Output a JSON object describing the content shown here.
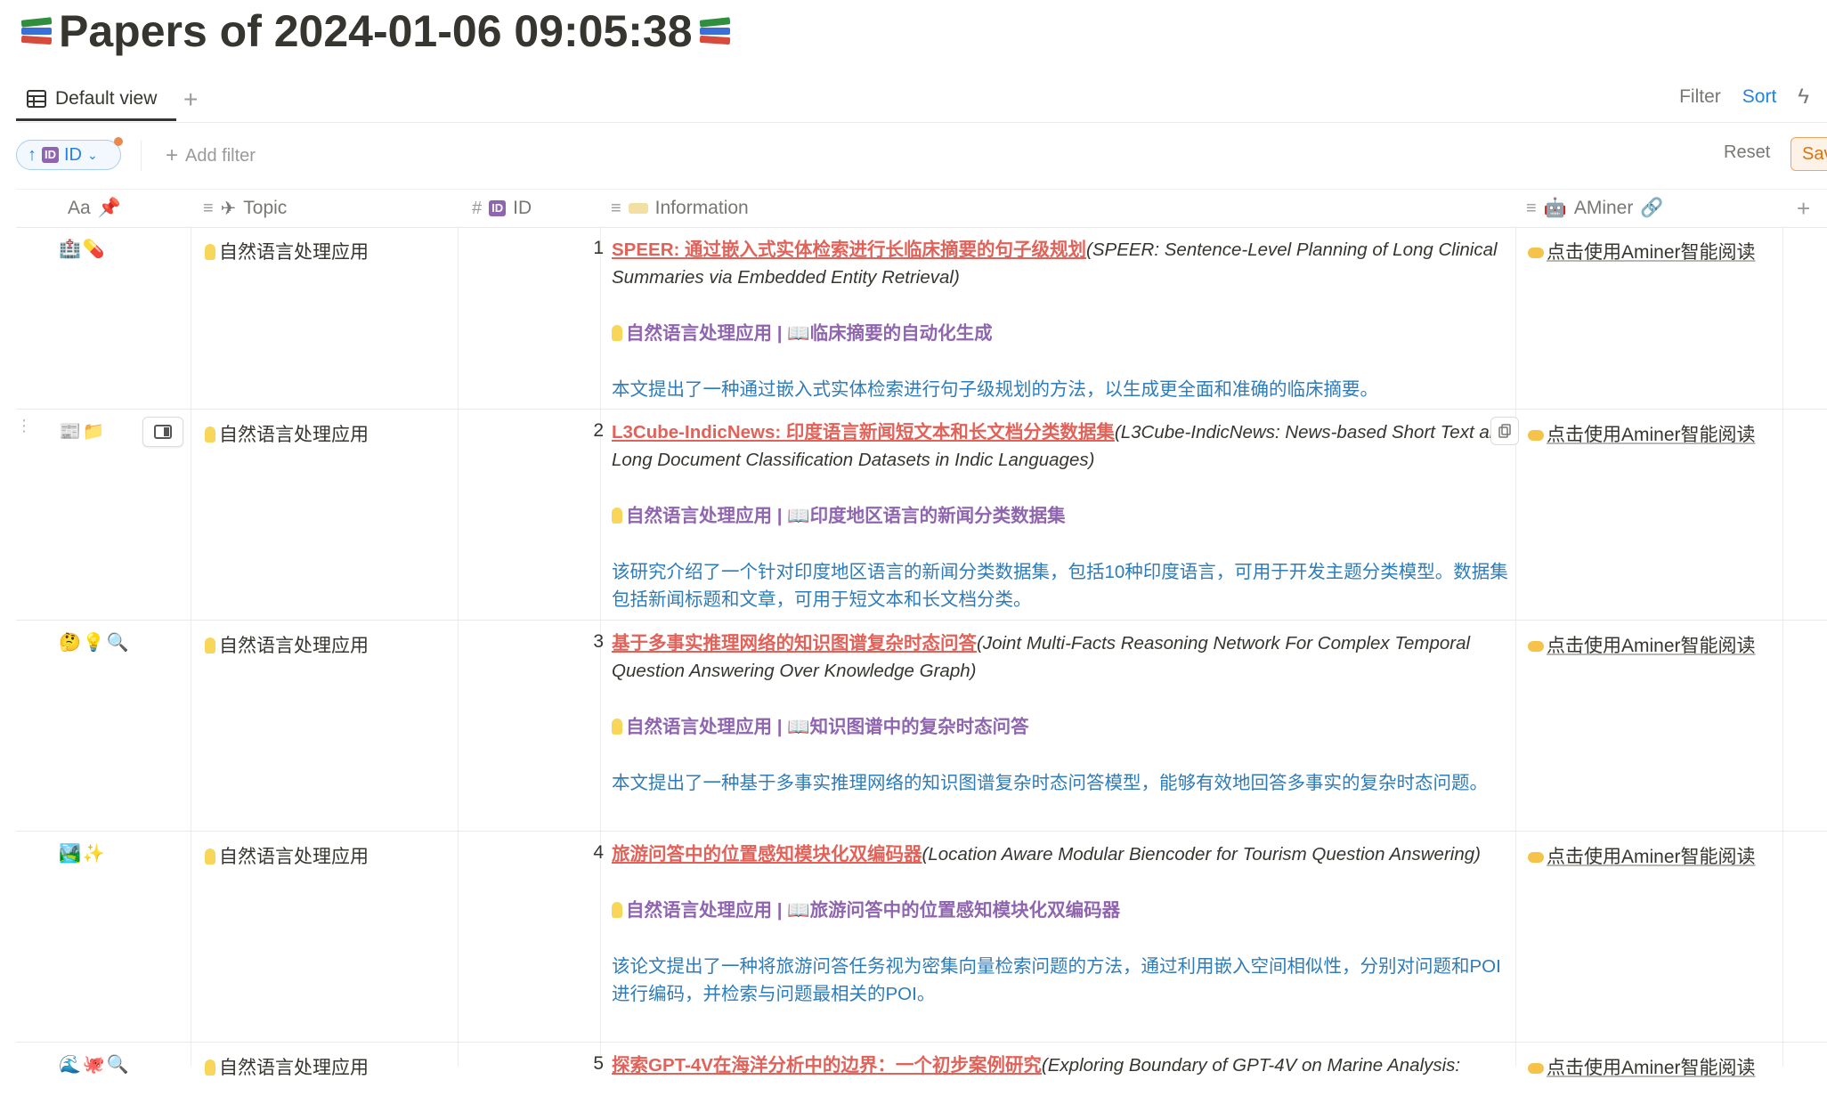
{
  "page": {
    "title": "Papers of 2024-01-06 09:05:38",
    "title_icon": "books-icon"
  },
  "tabs": [
    {
      "label": "Default view",
      "active": true
    }
  ],
  "toolbar": {
    "filter_label": "Filter",
    "sort_label": "Sort",
    "add_filter_label": "Add filter",
    "reset_label": "Reset",
    "save_label": "Sav",
    "sort_chip": {
      "direction": "↑",
      "badge": "ID",
      "label": "ID"
    }
  },
  "columns": [
    {
      "key": "name",
      "label": "Aa",
      "icon": "pin-icon"
    },
    {
      "key": "topic",
      "label": "Topic",
      "icon": "airplane-icon"
    },
    {
      "key": "id",
      "label": "ID",
      "icon": "hash-icon"
    },
    {
      "key": "info",
      "label": "Information",
      "icon": "tag-icon"
    },
    {
      "key": "aminer",
      "label": "AMiner",
      "icon": "robot-icon"
    }
  ],
  "rows": [
    {
      "emoji": "🏥💊",
      "topic": "自然语言处理应用",
      "id": "1",
      "title_zh": "SPEER: 通过嵌入式实体检索进行长临床摘要的句子级规划",
      "title_en": "(SPEER: Sentence-Level Planning of Long Clinical Summaries via Embedded Entity Retrieval)",
      "subtopic": "自然语言处理应用 | 📖临床摘要的自动化生成",
      "abstract": "本文提出了一种通过嵌入式实体检索进行句子级规划的方法，以生成更全面和准确的临床摘要。",
      "aminer": "点击使用Aminer智能阅读"
    },
    {
      "emoji": "📰📁",
      "topic": "自然语言处理应用",
      "id": "2",
      "title_zh": "L3Cube-IndicNews: 印度语言新闻短文本和长文档分类数据集",
      "title_en": "(L3Cube-IndicNews: News-based Short Text and Long Document Classification Datasets in Indic Languages)",
      "subtopic": "自然语言处理应用 | 📖印度地区语言的新闻分类数据集",
      "abstract": "该研究介绍了一个针对印度地区语言的新闻分类数据集，包括10种印度语言，可用于开发主题分类模型。数据集包括新闻标题和文章，可用于短文本和长文档分类。",
      "aminer": "点击使用Aminer智能阅读"
    },
    {
      "emoji": "🤔💡🔍",
      "topic": "自然语言处理应用",
      "id": "3",
      "title_zh": "基于多事实推理网络的知识图谱复杂时态问答",
      "title_en": "(Joint Multi-Facts Reasoning Network For Complex Temporal Question Answering Over Knowledge Graph)",
      "subtopic": "自然语言处理应用 | 📖知识图谱中的复杂时态问答",
      "abstract": "本文提出了一种基于多事实推理网络的知识图谱复杂时态问答模型，能够有效地回答多事实的复杂时态问题。",
      "aminer": "点击使用Aminer智能阅读"
    },
    {
      "emoji": "🏞️✨",
      "topic": "自然语言处理应用",
      "id": "4",
      "title_zh": "旅游问答中的位置感知模块化双编码器",
      "title_en": "(Location Aware Modular Biencoder for Tourism Question Answering)",
      "subtopic": "自然语言处理应用 | 📖旅游问答中的位置感知模块化双编码器",
      "abstract": "该论文提出了一种将旅游问答任务视为密集向量检索问题的方法，通过利用嵌入空间相似性，分别对问题和POI进行编码，并检索与问题最相关的POI。",
      "aminer": "点击使用Aminer智能阅读"
    },
    {
      "emoji": "🌊🐙🔍",
      "topic": "自然语言处理应用",
      "id": "5",
      "title_zh": "探索GPT-4V在海洋分析中的边界：一个初步案例研究",
      "title_en": "(Exploring Boundary of GPT-4V on Marine Analysis:",
      "subtopic": "",
      "abstract": "",
      "aminer": "点击使用Aminer智能阅读"
    }
  ]
}
